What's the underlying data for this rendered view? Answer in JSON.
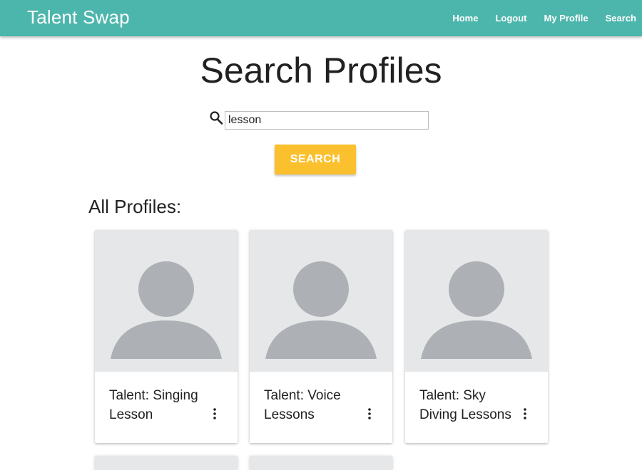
{
  "navbar": {
    "brand": "Talent Swap",
    "links": [
      "Home",
      "Logout",
      "My Profile",
      "Search"
    ],
    "color": "#4db6ac"
  },
  "page": {
    "title": "Search Profiles"
  },
  "search": {
    "value": "lesson",
    "button_label": "SEARCH",
    "button_color": "#fbc02d",
    "icon": "search-icon"
  },
  "profiles": {
    "heading": "All Profiles:",
    "cards": [
      {
        "title": "Talent: Singing Lesson",
        "avatar_icon": "person-icon",
        "menu_icon": "more-vert-icon"
      },
      {
        "title": "Talent: Voice Lessons",
        "avatar_icon": "person-icon",
        "menu_icon": "more-vert-icon"
      },
      {
        "title": "Talent: Sky Diving Lessons",
        "avatar_icon": "person-icon",
        "menu_icon": "more-vert-icon"
      }
    ]
  }
}
